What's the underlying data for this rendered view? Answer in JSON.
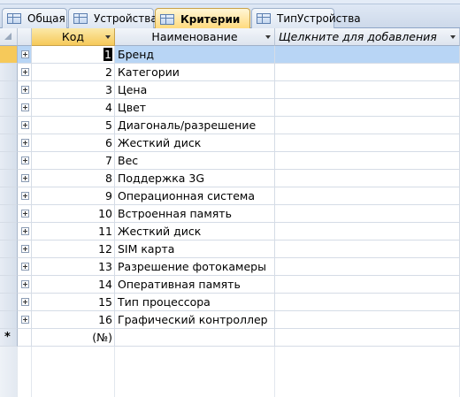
{
  "tabs": [
    {
      "label": "Общая",
      "active": false
    },
    {
      "label": "Устройства",
      "active": false
    },
    {
      "label": "Критерии",
      "active": true
    },
    {
      "label": "ТипУстройства",
      "active": false
    }
  ],
  "columns": {
    "kod": "Код",
    "name": "Наименование",
    "add": "Щелкните для добавления"
  },
  "rows": [
    {
      "kod": "1",
      "name": "Бренд"
    },
    {
      "kod": "2",
      "name": "Категории"
    },
    {
      "kod": "3",
      "name": "Цена"
    },
    {
      "kod": "4",
      "name": "Цвет"
    },
    {
      "kod": "5",
      "name": "Диагональ/разрешение"
    },
    {
      "kod": "6",
      "name": "Жесткий диск"
    },
    {
      "kod": "7",
      "name": "Вес"
    },
    {
      "kod": "8",
      "name": "Поддержка 3G"
    },
    {
      "kod": "9",
      "name": "Операционная система"
    },
    {
      "kod": "10",
      "name": "Встроенная память"
    },
    {
      "kod": "11",
      "name": "Жесткий диск"
    },
    {
      "kod": "12",
      "name": "SIM карта"
    },
    {
      "kod": "13",
      "name": "Разрешение фотокамеры"
    },
    {
      "kod": "14",
      "name": "Оперативная память"
    },
    {
      "kod": "15",
      "name": "Тип процессора"
    },
    {
      "kod": "16",
      "name": "Графический контроллер"
    }
  ],
  "new_row": {
    "marker": "*",
    "kod": "(№)"
  },
  "selected_row": 0
}
